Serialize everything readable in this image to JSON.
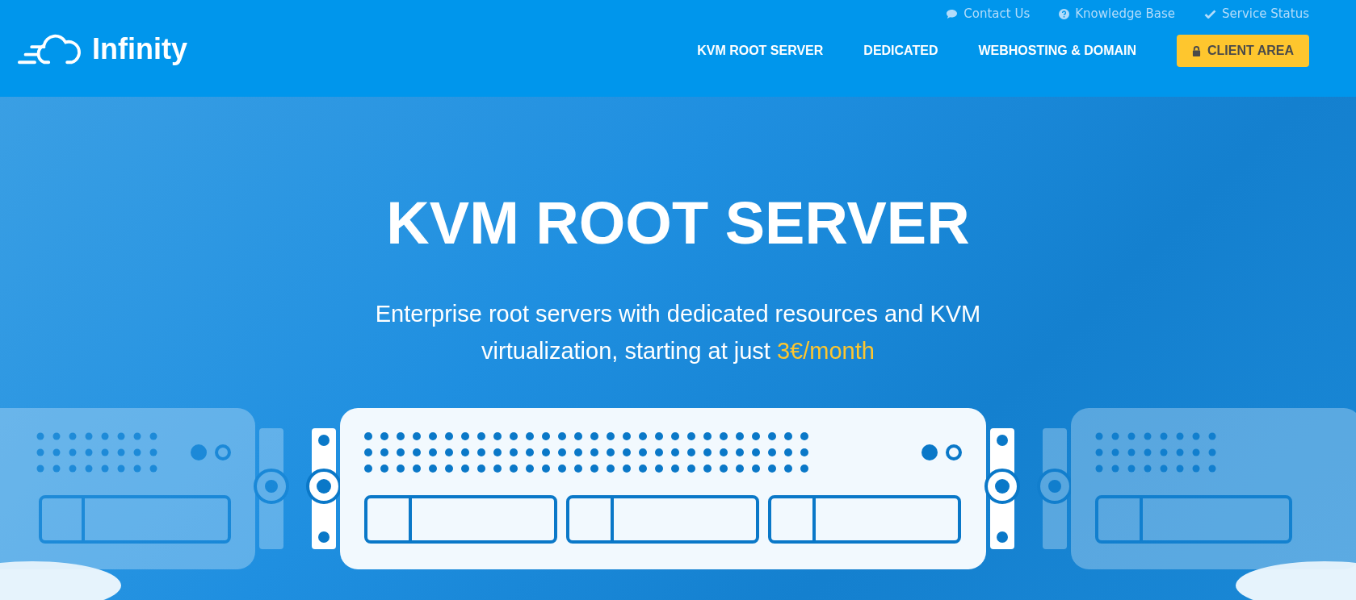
{
  "brand": {
    "name": "Infinity"
  },
  "top_links": [
    {
      "kind": "chat",
      "label": "Contact Us"
    },
    {
      "kind": "help",
      "label": "Knowledge Base"
    },
    {
      "kind": "check",
      "label": "Service Status"
    }
  ],
  "nav": [
    {
      "label": "KVM ROOT SERVER"
    },
    {
      "label": "DEDICATED"
    },
    {
      "label": "WEBHOSTING & DOMAIN"
    }
  ],
  "client_button": {
    "label": "CLIENT AREA"
  },
  "hero": {
    "title": "KVM ROOT SERVER",
    "subtitle": "Enterprise root servers with dedicated resources and KVM virtualization, starting at just",
    "price": "3€/month"
  }
}
